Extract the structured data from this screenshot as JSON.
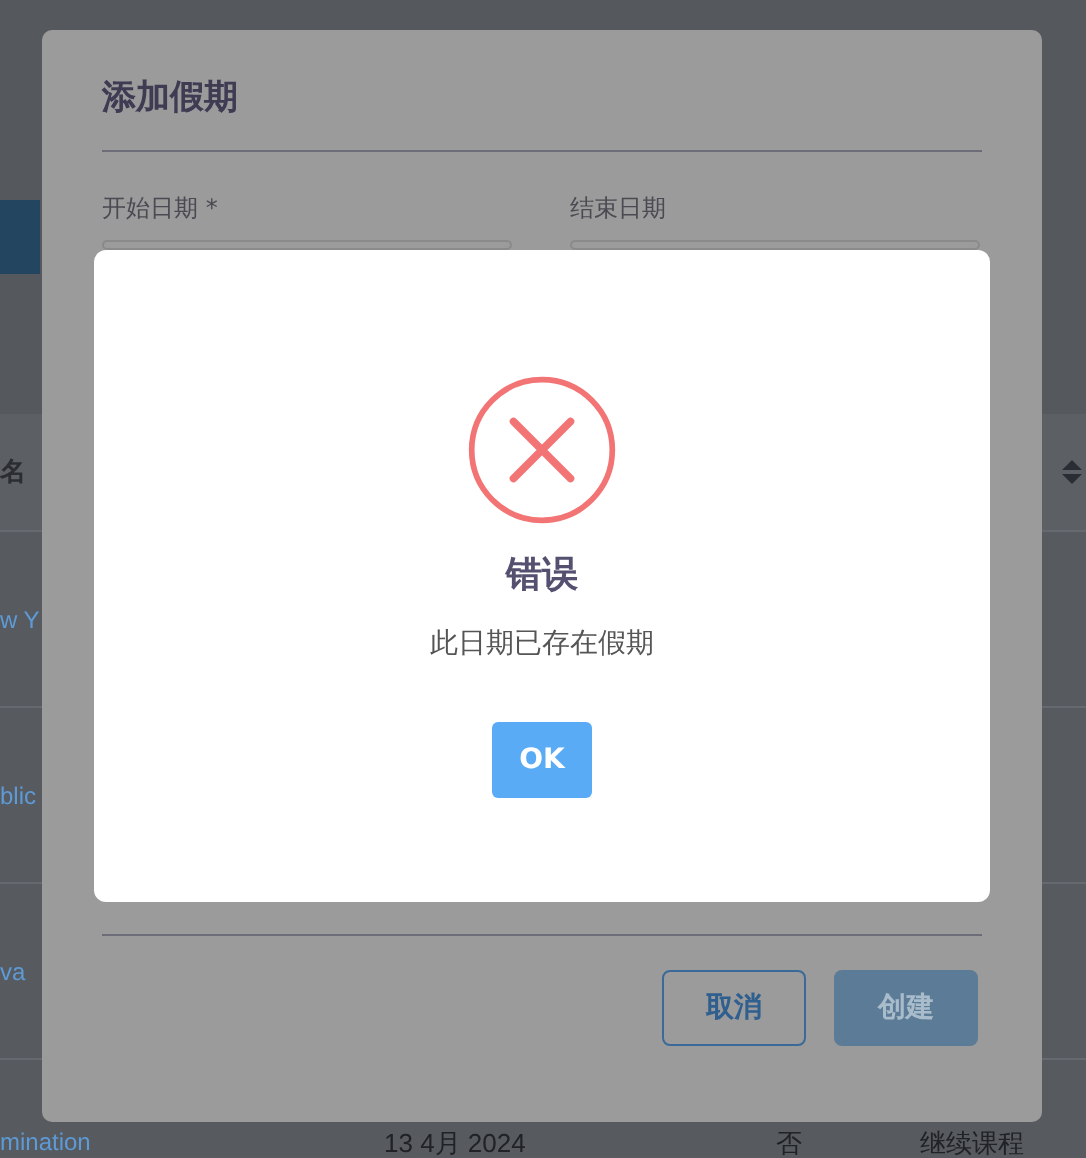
{
  "page": {
    "table": {
      "header": "名",
      "rows": [
        {
          "name": "w Y"
        },
        {
          "name": "blic"
        },
        {
          "name": "va"
        },
        {
          "name": "mination",
          "date": "13 4月 2024",
          "flag": "否",
          "action": "继续课程"
        }
      ]
    }
  },
  "dialog": {
    "title": "添加假期",
    "fields": [
      {
        "label": "开始日期 *"
      },
      {
        "label": "结束日期"
      }
    ],
    "buttons": [
      {
        "label": "取消",
        "kind": "outline"
      },
      {
        "label": "创建",
        "kind": "primary"
      }
    ]
  },
  "alert": {
    "kind": "error",
    "title": "错误",
    "message": "此日期已存在假期",
    "button": "OK"
  }
}
